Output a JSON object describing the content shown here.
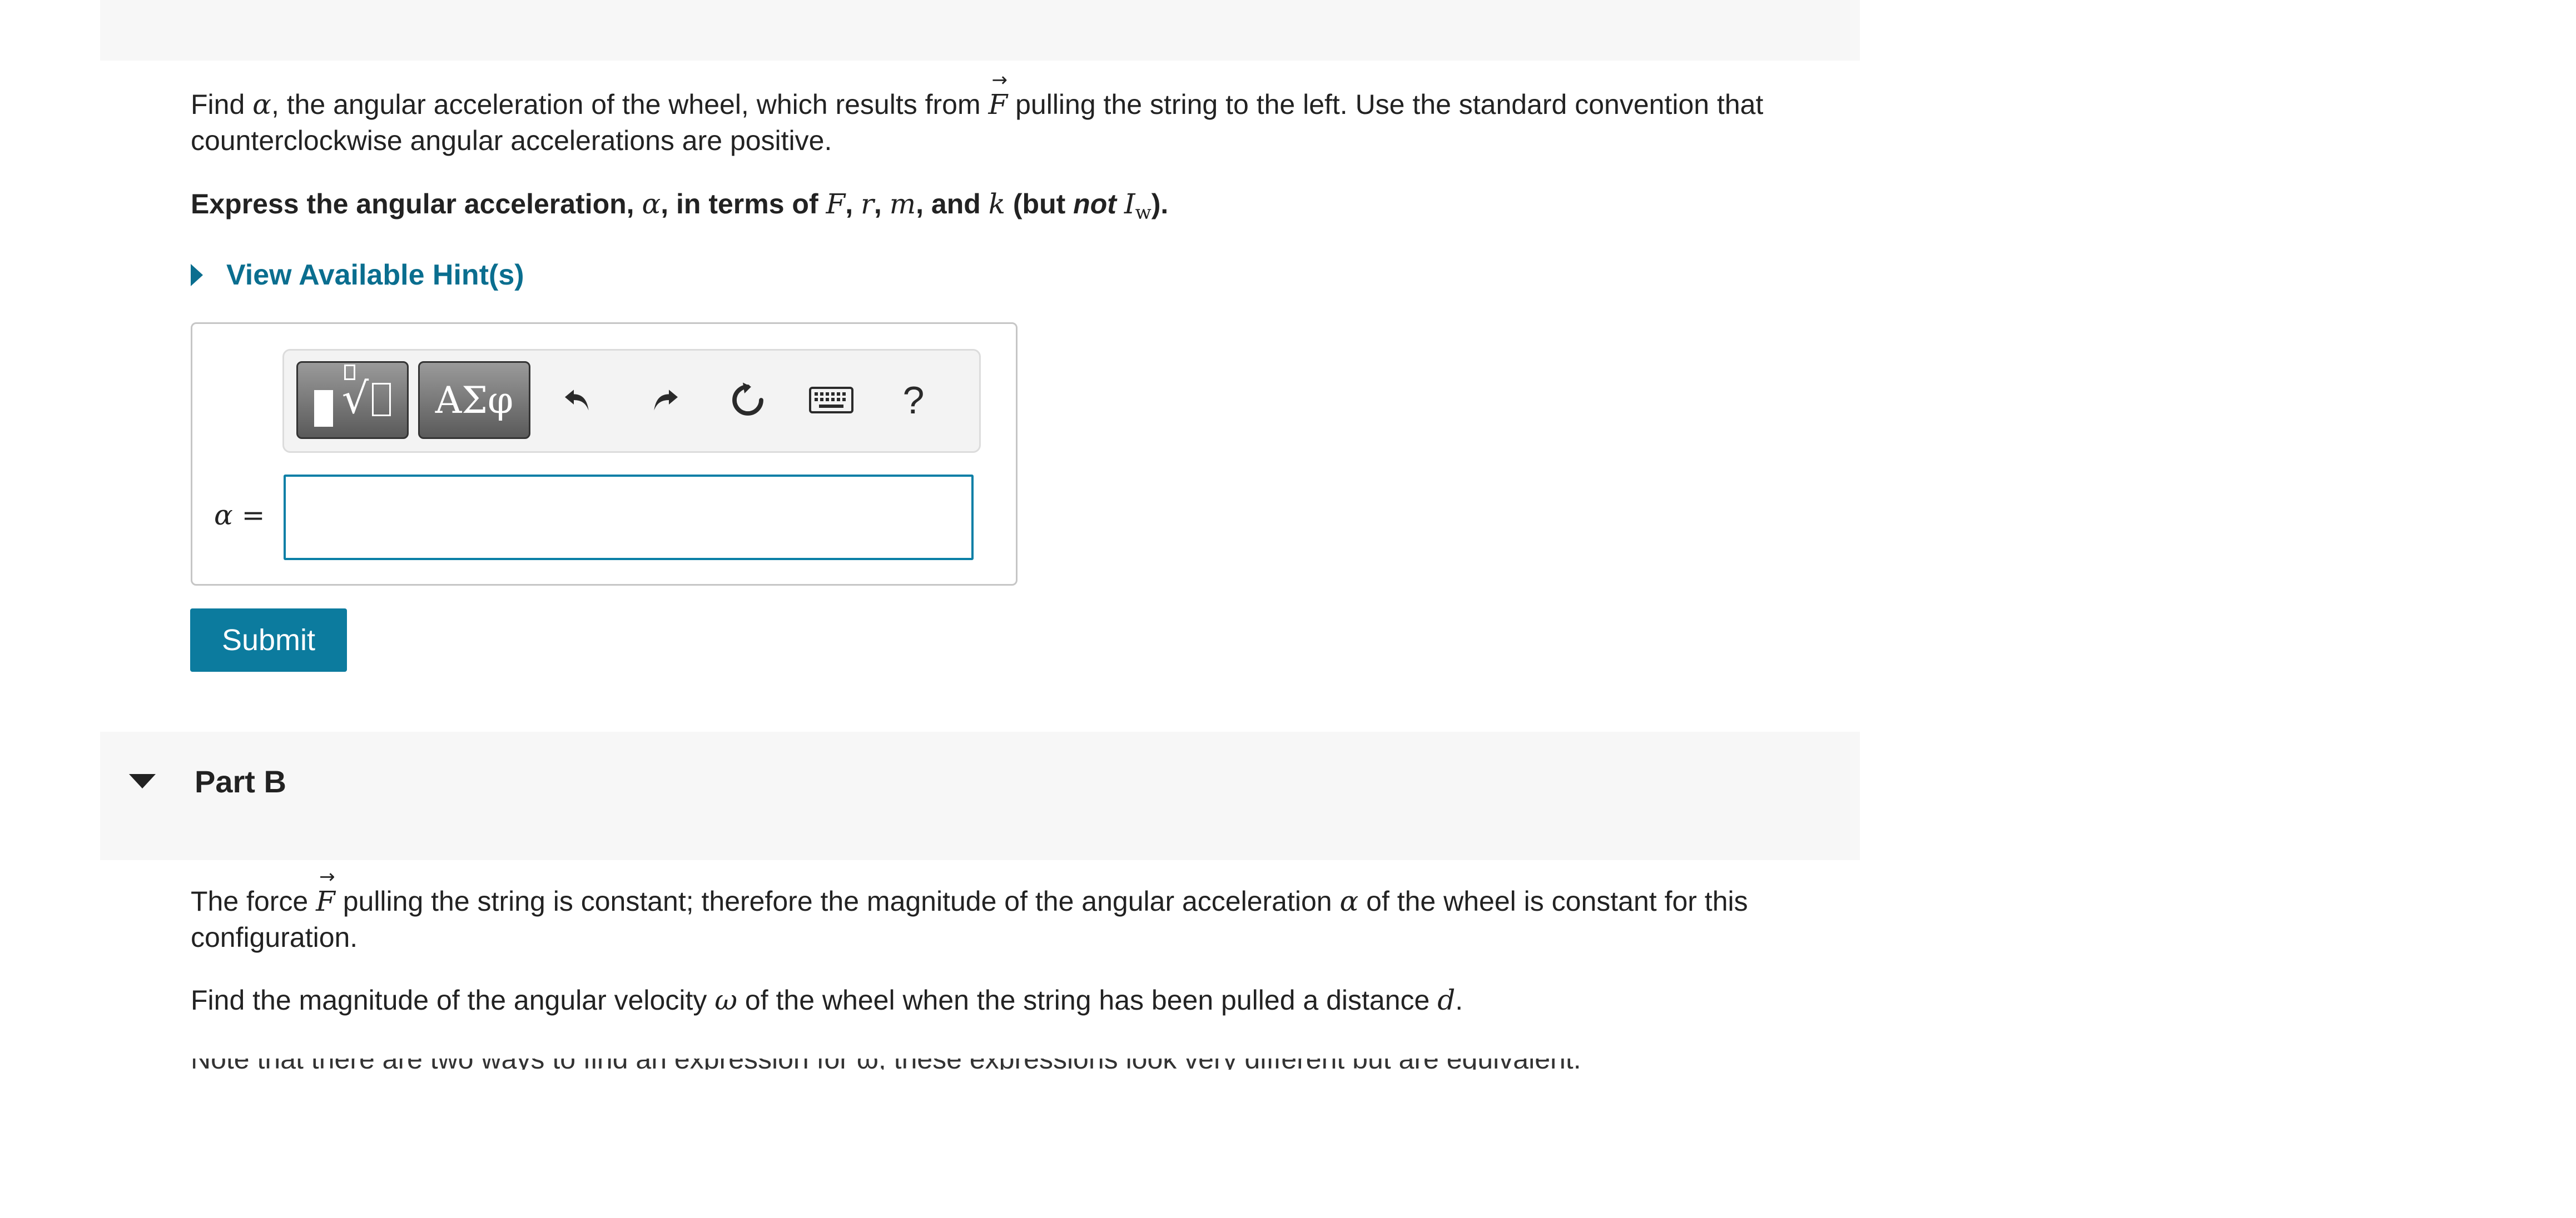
{
  "part_a": {
    "intro_1": "Find ",
    "intro_alpha": "α",
    "intro_2": ", the angular acceleration of the wheel, which results from ",
    "intro_F": "F",
    "intro_arrow": "→",
    "intro_3": " pulling the string to the left. Use the standard convention that counterclockwise angular accelerations are positive.",
    "express_1": "Express the angular acceleration, ",
    "express_alpha": "α",
    "express_2": ", in terms of ",
    "express_F": "F",
    "express_sep1": ", ",
    "express_r": "r",
    "express_sep2": ", ",
    "express_m": "m",
    "express_3": ", and ",
    "express_k": "k",
    "express_4": " (but ",
    "express_not": "not",
    "express_I": "I",
    "express_w": "w",
    "express_5": ")."
  },
  "hints": {
    "label": "View Available Hint(s)"
  },
  "toolbar": {
    "templates_icon": "templates-icon",
    "greek_label": "ΑΣφ",
    "undo_icon": "undo-icon",
    "redo_icon": "redo-icon",
    "reset_icon": "reset-icon",
    "keyboard_icon": "keyboard-icon",
    "help_label": "?"
  },
  "answer": {
    "label": "α =",
    "value": ""
  },
  "submit_label": "Submit",
  "part_b": {
    "title": "Part B",
    "p1_1": "The force ",
    "p1_F": "F",
    "p1_arrow": "→",
    "p1_2": " pulling the string is constant; therefore the magnitude of the angular acceleration ",
    "p1_alpha": "α",
    "p1_3": " of the wheel is constant for this configuration.",
    "p2_1": "Find the magnitude of the angular velocity ",
    "p2_omega": "ω",
    "p2_2": " of the wheel when the string has been pulled a distance ",
    "p2_d": "d",
    "p2_3": ".",
    "p3_cut": "Note that there are two ways to find an expression for ω; these expressions look very different but are equivalent."
  },
  "colors": {
    "accent": "#0c7b9e",
    "link": "#0a6e8f",
    "input_border": "#0a7fa6",
    "band": "#f7f7f7"
  }
}
